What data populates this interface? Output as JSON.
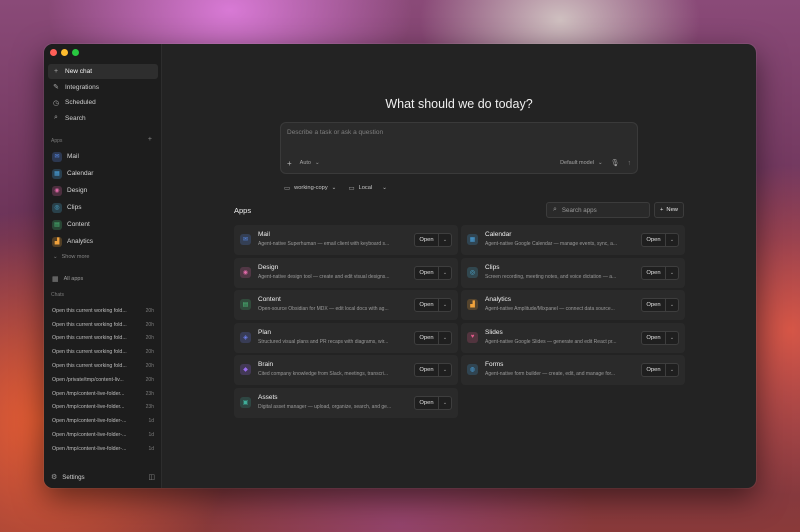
{
  "sidebar": {
    "nav": [
      {
        "label": "New chat",
        "icon": "plus-icon"
      },
      {
        "label": "Integrations",
        "icon": "plug-icon"
      },
      {
        "label": "Scheduled",
        "icon": "clock-icon"
      },
      {
        "label": "Search",
        "icon": "search-icon"
      }
    ],
    "apps_label": "Apps",
    "apps": [
      {
        "label": "Mail",
        "color": "#5a8dee"
      },
      {
        "label": "Calendar",
        "color": "#4aa3df"
      },
      {
        "label": "Design",
        "color": "#e069a8"
      },
      {
        "label": "Clips",
        "color": "#4fb0d8"
      },
      {
        "label": "Content",
        "color": "#4cc07a"
      },
      {
        "label": "Analytics",
        "color": "#f0a23c"
      }
    ],
    "show_more": "Show more",
    "all_apps": "All apps",
    "chats_label": "Chats",
    "chats": [
      {
        "title": "Open this current working fold...",
        "time": "20h"
      },
      {
        "title": "Open this current working fold...",
        "time": "20h"
      },
      {
        "title": "Open this current working fold...",
        "time": "20h"
      },
      {
        "title": "Open this current working fold...",
        "time": "20h"
      },
      {
        "title": "Open this current working fold...",
        "time": "20h"
      },
      {
        "title": "Open /private/tmp/content-liv...",
        "time": "20h"
      },
      {
        "title": "Open /tmp/content-live-folder...",
        "time": "23h"
      },
      {
        "title": "Open /tmp/content-live-folder...",
        "time": "23h"
      },
      {
        "title": "Open /tmp/content-live-folder-...",
        "time": "1d"
      },
      {
        "title": "Open /tmp/content-live-folder-...",
        "time": "1d"
      },
      {
        "title": "Open /tmp/content-live-folder-...",
        "time": "1d"
      }
    ],
    "settings_label": "Settings"
  },
  "main": {
    "headline": "What should we do today?",
    "prompt": {
      "placeholder": "Describe a task or ask a question",
      "mode": "Auto",
      "model": "Default model"
    },
    "context": {
      "folder": "working-copy",
      "env": "Local"
    },
    "apps_title": "Apps",
    "search_placeholder": "Search apps",
    "new_label": "New",
    "open_label": "Open",
    "cards": [
      {
        "name": "Mail",
        "desc": "Agent-native Superhuman — email client with keyboard s...",
        "color": "#5a8dee"
      },
      {
        "name": "Calendar",
        "desc": "Agent-native Google Calendar — manage events, sync, a...",
        "color": "#4aa3df"
      },
      {
        "name": "Design",
        "desc": "Agent-native design tool — create and edit visual designs...",
        "color": "#e069a8"
      },
      {
        "name": "Clips",
        "desc": "Screen recording, meeting notes, and voice dictation — a...",
        "color": "#4fb0d8"
      },
      {
        "name": "Content",
        "desc": "Open-source Obsidian for MDX — edit local docs with ag...",
        "color": "#4cc07a"
      },
      {
        "name": "Analytics",
        "desc": "Agent-native Amplitude/Mixpanel — connect data source...",
        "color": "#f0a23c"
      },
      {
        "name": "Plan",
        "desc": "Structured visual plans and PR recaps with diagrams, wir...",
        "color": "#6c7ff0"
      },
      {
        "name": "Slides",
        "desc": "Agent-native Google Slides — generate and edit React pr...",
        "color": "#e05a8a"
      },
      {
        "name": "Brain",
        "desc": "Cited company knowledge from Slack, meetings, transcri...",
        "color": "#9a6cf0"
      },
      {
        "name": "Forms",
        "desc": "Agent-native form builder — create, edit, and manage for...",
        "color": "#4aa3df"
      },
      {
        "name": "Assets",
        "desc": "Digital asset manager — upload, organize, search, and ge...",
        "color": "#3fae9a"
      }
    ]
  }
}
